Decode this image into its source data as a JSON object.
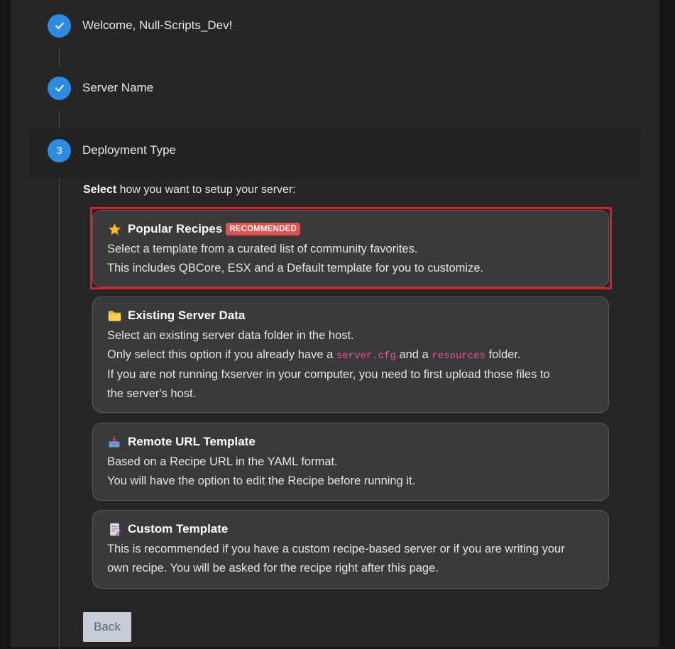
{
  "steps": [
    {
      "label": "Welcome, Null-Scripts_Dev!",
      "state": "done"
    },
    {
      "label": "Server Name",
      "state": "done"
    },
    {
      "label": "Deployment Type",
      "state": "active",
      "number": "3"
    }
  ],
  "intro": {
    "bold": "Select",
    "rest": " how you want to setup your server:"
  },
  "options": {
    "popular": {
      "icon": "star-icon",
      "title": "Popular Recipes",
      "badge": "RECOMMENDED",
      "line1": "Select a template from a curated list of community favorites.",
      "line2": "This includes QBCore, ESX and a Default template for you to customize."
    },
    "existing": {
      "icon": "folder-icon",
      "title": "Existing Server Data",
      "line1": "Select an existing server data folder in the host.",
      "line2_a": "Only select this option if you already have a ",
      "line2_code1": "server.cfg",
      "line2_b": " and a ",
      "line2_code2": "resources",
      "line2_c": " folder.",
      "line3": "If you are not running fxserver in your computer, you need to first upload those files to",
      "line4": "the server's host."
    },
    "remote": {
      "icon": "inbox-tray-icon",
      "title": "Remote URL Template",
      "line1": "Based on a Recipe URL in the YAML format.",
      "line2": "You will have the option to edit the Recipe before running it."
    },
    "custom": {
      "icon": "memo-icon",
      "title": "Custom Template",
      "line1": "This is recommended if you have a custom recipe-based server or if you are writing your",
      "line2": "own recipe. You will be asked for the recipe right after this page."
    }
  },
  "back_label": "Back",
  "colors": {
    "accent": "#2d8be2",
    "badge": "#e0524f",
    "highlight": "#e31b23",
    "code": "#e8589a"
  }
}
